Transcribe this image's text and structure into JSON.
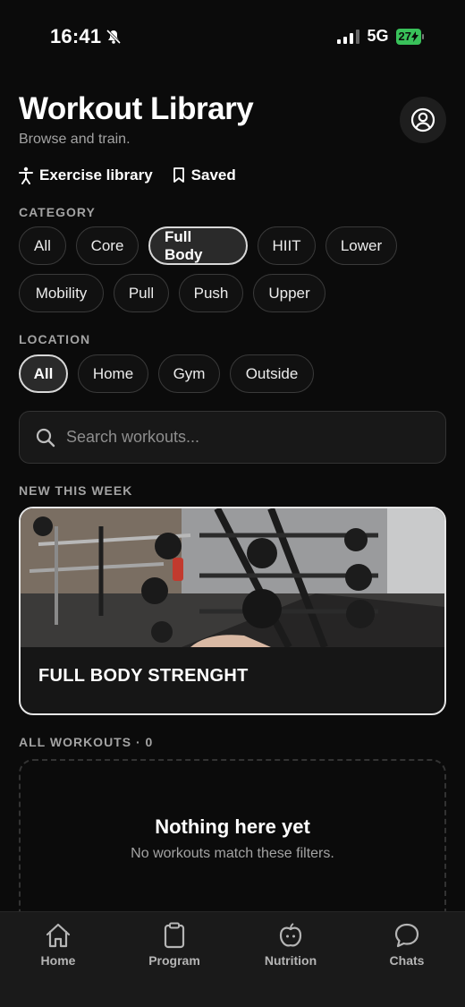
{
  "status": {
    "time": "16:41",
    "network": "5G",
    "battery": "27"
  },
  "header": {
    "title": "Workout Library",
    "subtitle": "Browse and train."
  },
  "links": {
    "exercise_library": "Exercise library",
    "saved": "Saved"
  },
  "category": {
    "label": "CATEGORY",
    "row1": [
      "All",
      "Core",
      "Full Body",
      "HIIT",
      "Lower"
    ],
    "row2": [
      "Mobility",
      "Pull",
      "Push",
      "Upper"
    ],
    "selected": "Full Body"
  },
  "location": {
    "label": "LOCATION",
    "options": [
      "All",
      "Home",
      "Gym",
      "Outside"
    ],
    "selected": "All"
  },
  "search": {
    "placeholder": "Search workouts..."
  },
  "new_this_week": {
    "label": "NEW THIS WEEK",
    "card_title": "FULL BODY STRENGHT"
  },
  "all_workouts": {
    "label": "ALL WORKOUTS · 0",
    "empty_title": "Nothing here yet",
    "empty_subtitle": "No workouts match these filters."
  },
  "tabs": {
    "home": "Home",
    "program": "Program",
    "nutrition": "Nutrition",
    "chats": "Chats"
  },
  "colors": {
    "background": "#0b0b0b",
    "battery": "#39c15a"
  }
}
